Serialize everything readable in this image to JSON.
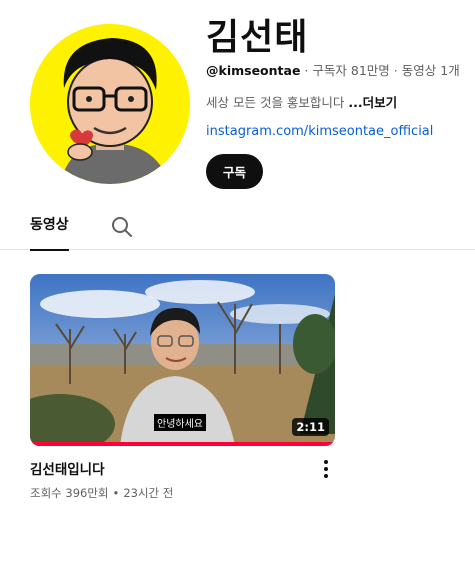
{
  "channel": {
    "name": "김선태",
    "handle": "@kimseontae",
    "subscribers": "구독자 81만명",
    "video_count": "동영상 1개",
    "description": "세상 모든 것을 홍보합니다",
    "more_label": "...더보기",
    "link": "instagram.com/kimseontae_official",
    "subscribe_label": "구독"
  },
  "tabs": {
    "videos_label": "동영상",
    "search_icon": "search-icon"
  },
  "video": {
    "title": "김선태입니다",
    "views": "조회수 396만회",
    "age": "23시간 전",
    "duration": "2:11",
    "caption": "안녕하세요",
    "watched_fraction": 1.0,
    "menu_icon": "more-vert-icon"
  },
  "colors": {
    "avatar_bg": "#fff200",
    "link": "#065fd4",
    "progress": "#ff0033"
  }
}
